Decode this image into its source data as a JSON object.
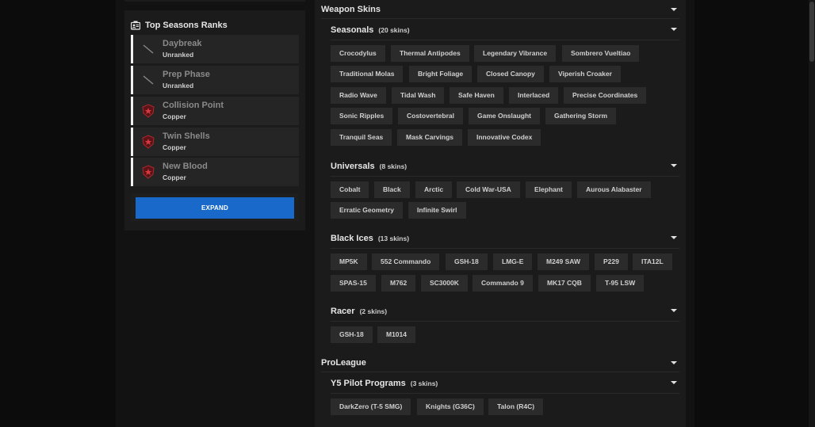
{
  "sidebar": {
    "title": "Top Seasons Ranks",
    "title_icon": "ranks-icon",
    "ranks": [
      {
        "name": "Daybreak",
        "tier": "Unranked",
        "icon": "unranked-slash-icon"
      },
      {
        "name": "Prep Phase",
        "tier": "Unranked",
        "icon": "unranked-slash-icon"
      },
      {
        "name": "Collision Point",
        "tier": "Copper",
        "icon": "copper-rank-icon"
      },
      {
        "name": "Twin Shells",
        "tier": "Copper",
        "icon": "copper-rank-icon"
      },
      {
        "name": "New Blood",
        "tier": "Copper",
        "icon": "copper-rank-icon"
      }
    ],
    "expand_label": "EXPAND"
  },
  "weapon_skins": {
    "title": "Weapon Skins",
    "groups": [
      {
        "title": "Seasonals",
        "count": "(20 skins)",
        "rows": [
          [
            "Crocodylus",
            "Thermal Antipodes",
            "Legendary Vibrance",
            "Sombrero Vueltiao"
          ],
          [
            "Traditional Molas",
            "Bright Foliage",
            "Closed Canopy",
            "Viperish Croaker"
          ],
          [
            "Radio Wave",
            "Tidal Wash",
            "Safe Haven",
            "Interlaced",
            "Precise Coordinates"
          ],
          [
            "Sonic Ripples",
            "Costovertebral",
            "Game Onslaught",
            "Gathering Storm"
          ],
          [
            "Tranquil Seas",
            "Mask Carvings",
            "Innovative Codex"
          ]
        ]
      },
      {
        "title": "Universals",
        "count": "(8 skins)",
        "rows": [
          [
            "Cobalt",
            "Black",
            "Arctic",
            "Cold War-USA",
            "Elephant",
            "Aurous Alabaster"
          ],
          [
            "Erratic Geometry",
            "Infinite Swirl"
          ]
        ]
      },
      {
        "title": "Black Ices",
        "count": "(13 skins)",
        "rows": [
          [
            "MP5K",
            "552 Commando",
            "GSH-18",
            "LMG-E",
            "M249 SAW",
            "P229",
            "ITA12L"
          ],
          [
            "SPAS-15",
            "M762",
            "SC3000K",
            "Commando 9",
            "MK17 CQB",
            "T-95 LSW"
          ]
        ]
      },
      {
        "title": "Racer",
        "count": "(2 skins)",
        "rows": [
          [
            "GSH-18",
            "M1014"
          ]
        ]
      }
    ]
  },
  "proleague": {
    "title": "ProLeague",
    "groups": [
      {
        "title": "Y5 Pilot Programs",
        "count": "(3 skins)",
        "rows": [
          [
            "DarkZero (T-5 SMG)",
            "Knights (G36C)",
            "Talon (R4C)"
          ]
        ]
      }
    ]
  },
  "colors": {
    "accent_button": "#1869c9",
    "panel": "#1b1b1b",
    "chip": "#2b2b2b",
    "copper_rank": "#b0282e"
  }
}
